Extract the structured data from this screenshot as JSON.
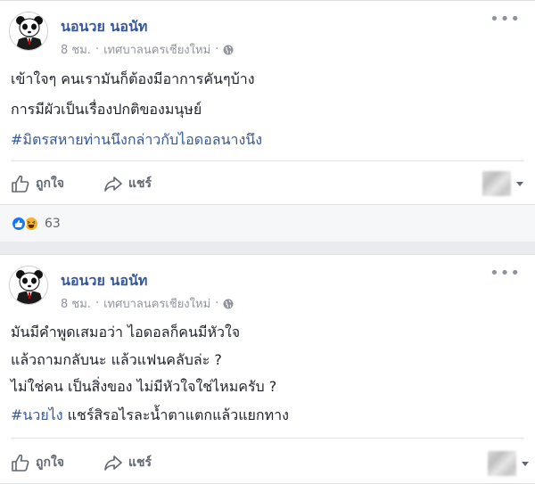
{
  "posts": [
    {
      "author": "นอนวย นอนัท",
      "time": "8 ชม.",
      "separator": "·",
      "location": "เทศบาลนครเชียงใหม่",
      "lines": [
        "เข้าใจๆ คนเรามันก็ต้องมีอาการคันๆบ้าง",
        "การมีผัวเป็นเรื่องปกติของมนุษย์"
      ],
      "hashtag": "#มิตรสหายท่านนึงกล่าวกับไอดอลนางนึง",
      "like_label": "ถูกใจ",
      "share_label": "แชร์",
      "reaction_count": "63"
    },
    {
      "author": "นอนวย นอนัท",
      "time": "8 ชม.",
      "separator": "·",
      "location": "เทศบาลนครเชียงใหม่",
      "lines": [
        "มันมีคำพูดเสมอว่า ไอดอลก็คนมีหัวใจ",
        "แล้วถามกลับนะ แล้วแฟนคลับล่ะ ?",
        "ไม่ใช่คน เป็นสิ่งของ ไม่มีหัวใจใช่ไหมครับ ?"
      ],
      "hashtag": "#นวยไง",
      "tail": " แชร์สิรอไรละน้ำตาแตกแล้วแยกทาง",
      "like_label": "ถูกใจ",
      "share_label": "แชร์"
    }
  ],
  "colors": {
    "author": "#365899",
    "hashtag": "#365899",
    "like": "#1877f2",
    "haha": "#f7b125"
  },
  "icons": {
    "more": "more-options-icon",
    "globe": "globe-icon",
    "like": "thumbs-up-icon",
    "share": "share-arrow-icon"
  }
}
